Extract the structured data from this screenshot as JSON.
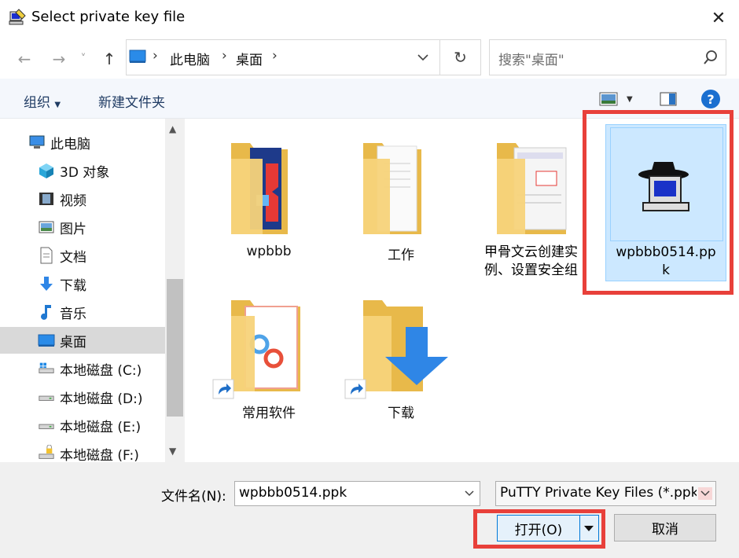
{
  "window": {
    "title": "Select private key file",
    "close_glyph": "✕"
  },
  "nav": {
    "back_glyph": "←",
    "forward_glyph": "→",
    "recent_glyph": "˅",
    "up_glyph": "↑",
    "breadcrumb": [
      "此电脑",
      "桌面"
    ],
    "separator": "›",
    "refresh_glyph": "↻",
    "search_placeholder": "搜索\"桌面\""
  },
  "toolbar": {
    "organize": "组织",
    "new_folder": "新建文件夹",
    "help_glyph": "?"
  },
  "sidebar": {
    "items": [
      {
        "label": "此电脑",
        "icon": "computer-icon"
      },
      {
        "label": "3D 对象",
        "icon": "cube-icon"
      },
      {
        "label": "视频",
        "icon": "film-icon"
      },
      {
        "label": "图片",
        "icon": "picture-icon"
      },
      {
        "label": "文档",
        "icon": "document-icon"
      },
      {
        "label": "下载",
        "icon": "download-arrow-icon"
      },
      {
        "label": "音乐",
        "icon": "music-note-icon"
      },
      {
        "label": "桌面",
        "icon": "desktop-icon",
        "selected": true
      },
      {
        "label": "本地磁盘 (C:)",
        "icon": "drive-windows-icon"
      },
      {
        "label": "本地磁盘 (D:)",
        "icon": "drive-icon"
      },
      {
        "label": "本地磁盘 (E:)",
        "icon": "drive-icon"
      },
      {
        "label": "本地磁盘 (F:)",
        "icon": "drive-locked-icon"
      }
    ]
  },
  "files": [
    {
      "name": "wpbbb",
      "type": "folder"
    },
    {
      "name": "工作",
      "type": "folder"
    },
    {
      "name_line1": "甲骨文云创建实",
      "name_line2": "例、设置安全组",
      "type": "folder"
    },
    {
      "name_line1": "wpbbb0514.pp",
      "name_line2": "k",
      "type": "ppk-file",
      "selected": true
    },
    {
      "name": "常用软件",
      "type": "folder-shortcut"
    },
    {
      "name": "下载",
      "type": "folder-shortcut"
    }
  ],
  "footer": {
    "filename_label": "文件名(N):",
    "filename_value": "wpbbb0514.ppk",
    "filetype_value": "PuTTY Private Key Files (*.ppk)",
    "open_label": "打开(O)",
    "cancel_label": "取消"
  },
  "colors": {
    "highlight": "#e8403a",
    "selection": "#cce8ff",
    "accent": "#0078d7"
  }
}
